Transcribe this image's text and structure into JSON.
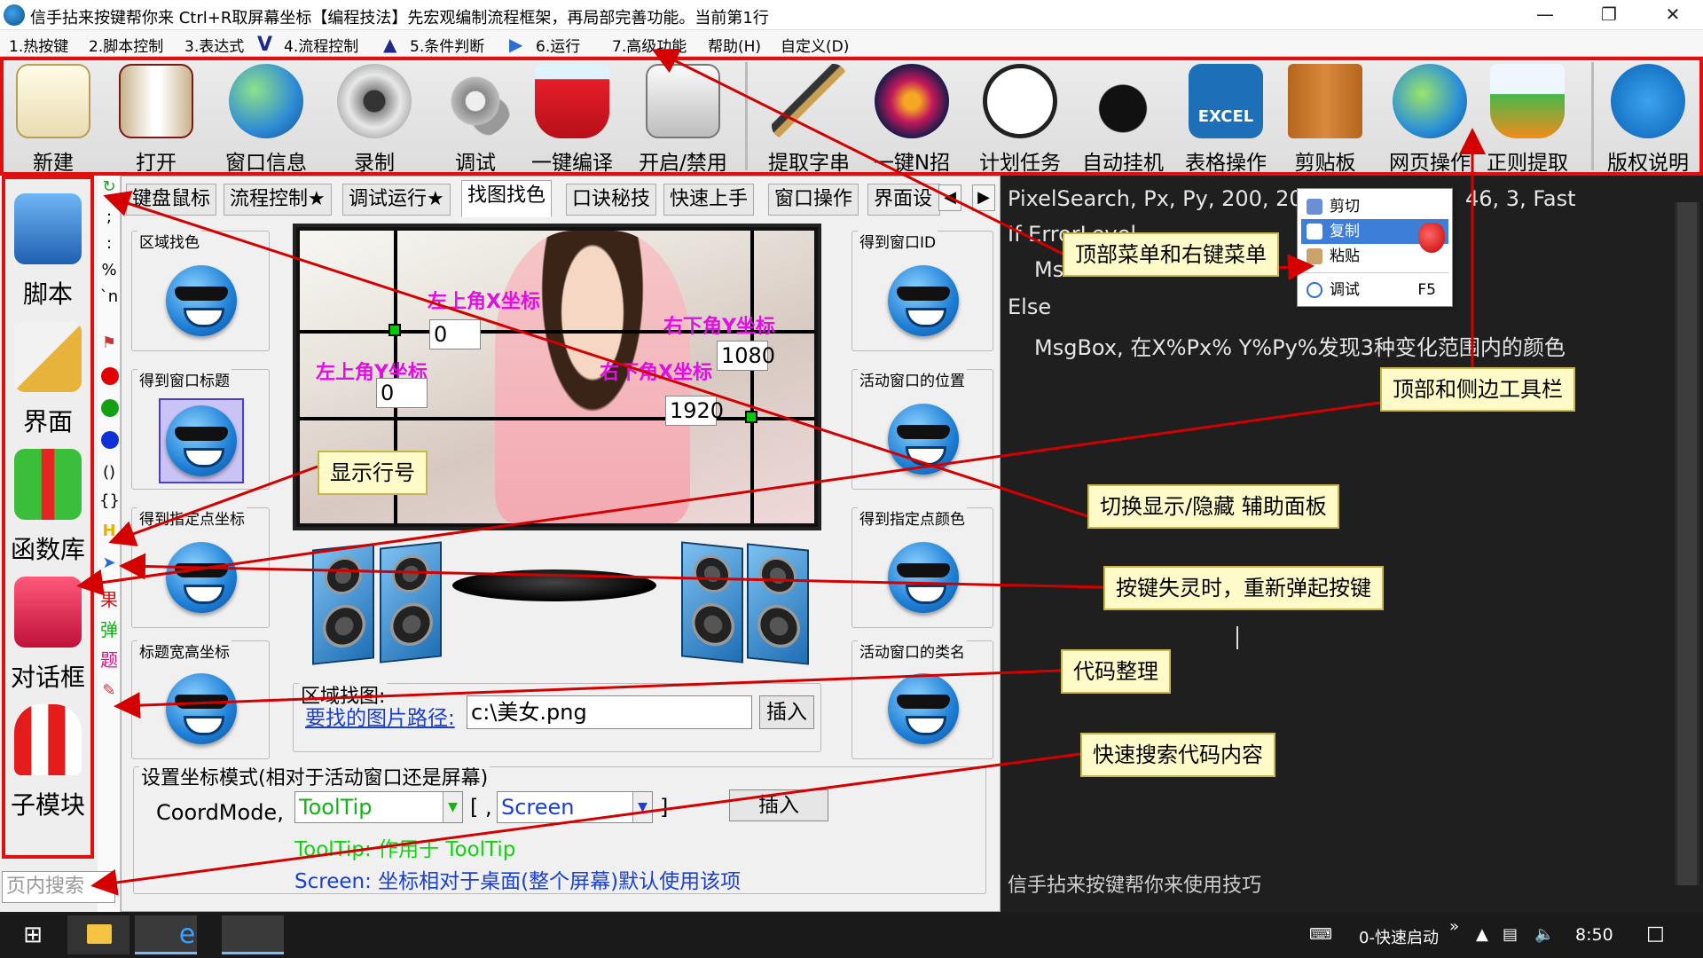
{
  "window": {
    "title": "信手拈来按键帮你来 Ctrl+R取屏幕坐标【编程技法】先宏观编制流程框架，再局部完善功能。当前第1行",
    "min_icon": "minimize-icon",
    "max_icon": "maximize-icon",
    "close_icon": "close-icon"
  },
  "menubar": [
    "1.热按键",
    "2.脚本控制",
    "3.表达式",
    "4.流程控制",
    "5.条件判断",
    "6.运行",
    "7.高级功能",
    "帮助(H)",
    "自定义(D)"
  ],
  "toolbar": [
    {
      "label": "新建",
      "icon": "notepad-pencil-icon"
    },
    {
      "label": "打开",
      "icon": "open-book-icon"
    },
    {
      "label": "窗口信息",
      "icon": "globe-cursor-icon"
    },
    {
      "label": "录制",
      "icon": "webcam-icon"
    },
    {
      "label": "调试",
      "icon": "gears-icon"
    },
    {
      "label": "一键编译",
      "icon": "paint-bucket-icon"
    },
    {
      "label": "开启/禁用",
      "icon": "keyboard-keys-icon"
    },
    {
      "label": "提取字串",
      "icon": "fountain-pen-icon"
    },
    {
      "label": "一键N招",
      "icon": "fighter-icon"
    },
    {
      "label": "计划任务",
      "icon": "clock-icon"
    },
    {
      "label": "自动挂机",
      "icon": "rabbit-icon"
    },
    {
      "label": "表格操作",
      "icon": "excel-icon"
    },
    {
      "label": "剪贴板",
      "icon": "clipboard-icon"
    },
    {
      "label": "网页操作",
      "icon": "www-globe-icon"
    },
    {
      "label": "正则提取",
      "icon": "lab-flask-icon"
    },
    {
      "label": "版权说明",
      "icon": "accessibility-icon"
    }
  ],
  "sidebar": [
    {
      "label": "脚本",
      "icon": "address-book-icon"
    },
    {
      "label": "界面",
      "icon": "ruler-triangle-icon"
    },
    {
      "label": "函数库",
      "icon": "gift-box-icon"
    },
    {
      "label": "对话框",
      "icon": "mailbox-icon"
    },
    {
      "label": "子模块",
      "icon": "popcorn-icon"
    }
  ],
  "gutter": {
    "lines": [
      ";",
      ":",
      "%",
      "`n",
      "()",
      "{}"
    ],
    "bottom_text": [
      "果",
      "弹",
      "题"
    ]
  },
  "tabs": [
    "键盘鼠标",
    "流程控制★",
    "调试运行★",
    "找图找色",
    "口诀秘技",
    "快速上手",
    "窗口操作",
    "界面设"
  ],
  "active_tab": 3,
  "groups_left": [
    "区域找色",
    "得到窗口标题",
    "得到指定点坐标",
    "标题宽高坐标"
  ],
  "groups_right": [
    "得到窗口ID",
    "活动窗口的位置",
    "得到指定点颜色",
    "活动窗口的类名"
  ],
  "monitor": {
    "top_left_x_label": "左上角X坐标",
    "top_left_y_label": "左上角Y坐标",
    "bottom_right_y_label": "右下角Y坐标",
    "bottom_right_x_label": "右下角X坐标",
    "top_left_x": "0",
    "top_left_y": "0",
    "bottom_right_y": "1080",
    "bottom_right_x": "1920"
  },
  "image_search": {
    "group_title": "区域找图:",
    "path_label": "要找的图片路径:",
    "path_value": "c:\\美女.png",
    "insert": "插入"
  },
  "coord_mode": {
    "group_title": "设置坐标模式(相对于活动窗口还是屏幕)",
    "label": "CoordMode,",
    "target": "ToolTip",
    "bracket_open": "[ ,",
    "relative": "Screen",
    "bracket_close": "]",
    "insert": "插入",
    "hint1": "ToolTip: 作用于 ToolTip",
    "hint2": "Screen: 坐标相对于桌面(整个屏幕)默认使用该项"
  },
  "code": {
    "line1a": "PixelSearch, Px, Py, 200, 20",
    "line1b": "46, 3, Fast",
    "line2": "If ErrorLevel",
    "line3": "Ms",
    "line4": "Else",
    "line5": "MsgBox, 在X%Px% Y%Py%发现3种变化范围内的颜色",
    "status": "信手拈来按键帮你来使用技巧"
  },
  "context_menu": [
    {
      "label": "剪切",
      "icon": "scissors-icon",
      "shortcut": ""
    },
    {
      "label": "复制",
      "icon": "copy-icon",
      "shortcut": ""
    },
    {
      "label": "粘贴",
      "icon": "paste-icon",
      "shortcut": ""
    },
    {
      "label": "调试",
      "icon": "debug-icon",
      "shortcut": "F5"
    }
  ],
  "callouts": {
    "menu": "顶部菜单和右键菜单",
    "toolbar": "顶部和侧边工具栏",
    "line_numbers": "显示行号",
    "toggle_panel": "切换显示/隐藏 辅助面板",
    "release_keys": "按键失灵时，重新弹起按键",
    "format": "代码整理",
    "search": "快速搜索代码内容"
  },
  "search": {
    "placeholder": "页内搜索"
  },
  "taskbar": {
    "quick_launch": "0-快速启动",
    "time": "8:50"
  },
  "colors": {
    "accent_red": "#e01010",
    "callout_bg": "#fffbc8",
    "magenta_label": "#e20fe2",
    "code_bg": "#1f1f1f"
  }
}
